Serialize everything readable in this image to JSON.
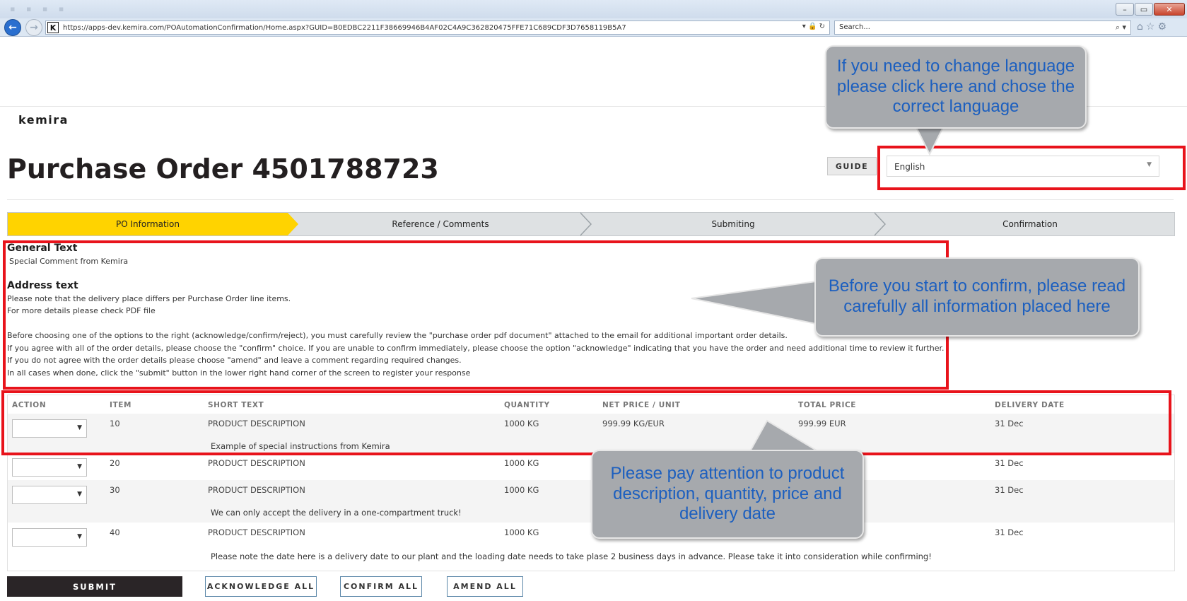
{
  "browser": {
    "url": "https://apps-dev.kemira.com/POAutomationConfirmation/Home.aspx?GUID=B0EDBC2211F38669946B4AF02C4A9C362820475FFE71C689CDF3D7658119B5A7",
    "search_placeholder": "Search...",
    "favicon_letter": "K",
    "window_controls": {
      "minimize": "–",
      "maximize": "▭",
      "close": "✕"
    },
    "icons": [
      "back-arrow-icon",
      "forward-arrow-icon",
      "lock-icon",
      "refresh-icon",
      "search-icon",
      "home-icon",
      "star-icon",
      "gear-icon"
    ]
  },
  "header": {
    "logo": "kemira",
    "title": "Purchase Order 4501788723",
    "guide_label": "GUIDE",
    "language_value": "English"
  },
  "steps": [
    {
      "label": "PO Information",
      "active": true
    },
    {
      "label": "Reference / Comments",
      "active": false
    },
    {
      "label": "Submiting",
      "active": false
    },
    {
      "label": "Confirmation",
      "active": false
    }
  ],
  "info": {
    "general_title": "General Text",
    "general_body": "Special Comment from Kemira",
    "address_title": "Address text",
    "lines": [
      "Please note that the delivery place differs per Purchase Order line items.",
      "For more details please check PDF file",
      "Before choosing one of the options to the right (acknowledge/confirm/reject), you must carefully review the \"purchase order pdf document\" attached to the email for additional important order details.",
      "If you agree with all of the order details, please choose the \"confirm\" choice. If you are unable to confirm immediately, please choose the option \"acknowledge\" indicating that you have the order and need additional time to review it further.",
      "If you do not agree with the order details please choose \"amend\" and leave a comment regarding required changes.",
      "In all cases when done, click the \"submit\" button in the lower right hand corner of the screen to register your response"
    ]
  },
  "table": {
    "headers": [
      "ACTION",
      "ITEM",
      "SHORT TEXT",
      "QUANTITY",
      "NET PRICE / UNIT",
      "TOTAL PRICE",
      "DELIVERY DATE"
    ],
    "rows": [
      {
        "item": "10",
        "short_text": "PRODUCT DESCRIPTION",
        "quantity": "1000 KG",
        "net_price": "999.99 KG/EUR",
        "total_price": "999.99 EUR",
        "delivery": "31 Dec",
        "note": "Example of special instructions from Kemira"
      },
      {
        "item": "20",
        "short_text": "PRODUCT DESCRIPTION",
        "quantity": "1000 KG",
        "net_price": "",
        "total_price": "",
        "delivery": "31 Dec",
        "note": ""
      },
      {
        "item": "30",
        "short_text": "PRODUCT DESCRIPTION",
        "quantity": "1000 KG",
        "net_price": "",
        "total_price": "",
        "delivery": "31 Dec",
        "note": "We can only accept the delivery in a one-compartment truck!"
      },
      {
        "item": "40",
        "short_text": "PRODUCT DESCRIPTION",
        "quantity": "1000 KG",
        "net_price": "",
        "total_price": "",
        "delivery": "31 Dec",
        "note": "Please note the date here is a delivery date to our plant and the loading date needs to take plase 2 business days in advance. Please take it into consideration while confirming!"
      }
    ]
  },
  "buttons": {
    "submit": "SUBMIT",
    "acknowledge_all": "ACKNOWLEDGE ALL",
    "confirm_all": "CONFIRM ALL",
    "amend_all": "AMEND ALL"
  },
  "callouts": {
    "language": "If you need to change language please click here and chose the correct language",
    "read_info": "Before you start to confirm, please read carefully all information placed here",
    "attention": "Please pay attention to product description, quantity, price and delivery date"
  },
  "colors": {
    "step_active": "#ffd300",
    "highlight_frame": "#e8131b",
    "callout_text": "#1c5fbf",
    "submit_bg": "#2a2527"
  }
}
